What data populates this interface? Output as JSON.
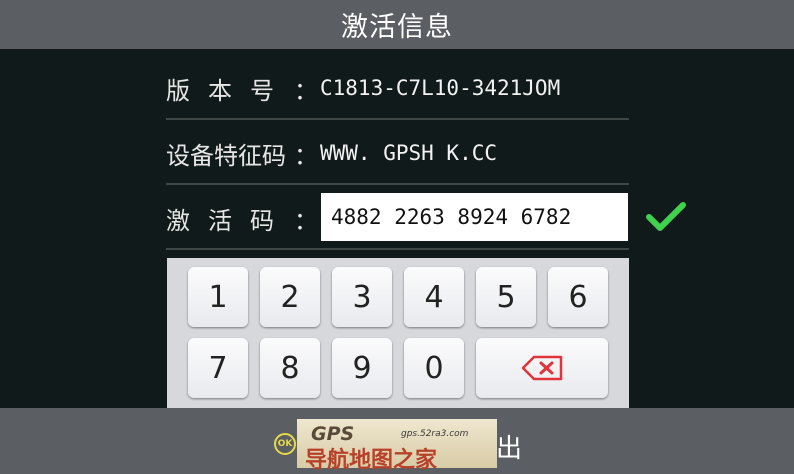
{
  "header": {
    "title": "激活信息"
  },
  "info": {
    "version_label_chars": [
      "版",
      "本",
      "号"
    ],
    "version_value": "C1813-C7L10-3421JOM",
    "feature_label": "设备特征码",
    "feature_value": "WWW. GPSH K.CC",
    "activation_label_chars": [
      "激",
      "活",
      "码"
    ],
    "activation_value": "4882 2263 8924 6782",
    "colon": "："
  },
  "keypad": {
    "row1": [
      "1",
      "2",
      "3",
      "4",
      "5",
      "6"
    ],
    "row2": [
      "7",
      "8",
      "9",
      "0"
    ],
    "backspace_icon": "backspace-icon"
  },
  "footer": {
    "ok_label": "OK",
    "exit_label": "出"
  },
  "watermark": {
    "brand": "GPS",
    "url": "gps.52ra3.com",
    "name": "导航地图之家"
  },
  "colors": {
    "background": "#111a1a",
    "bar": "#5b5e62",
    "check": "#3fd24f",
    "backspace": "#e0343a",
    "ok": "#e3d94a"
  }
}
